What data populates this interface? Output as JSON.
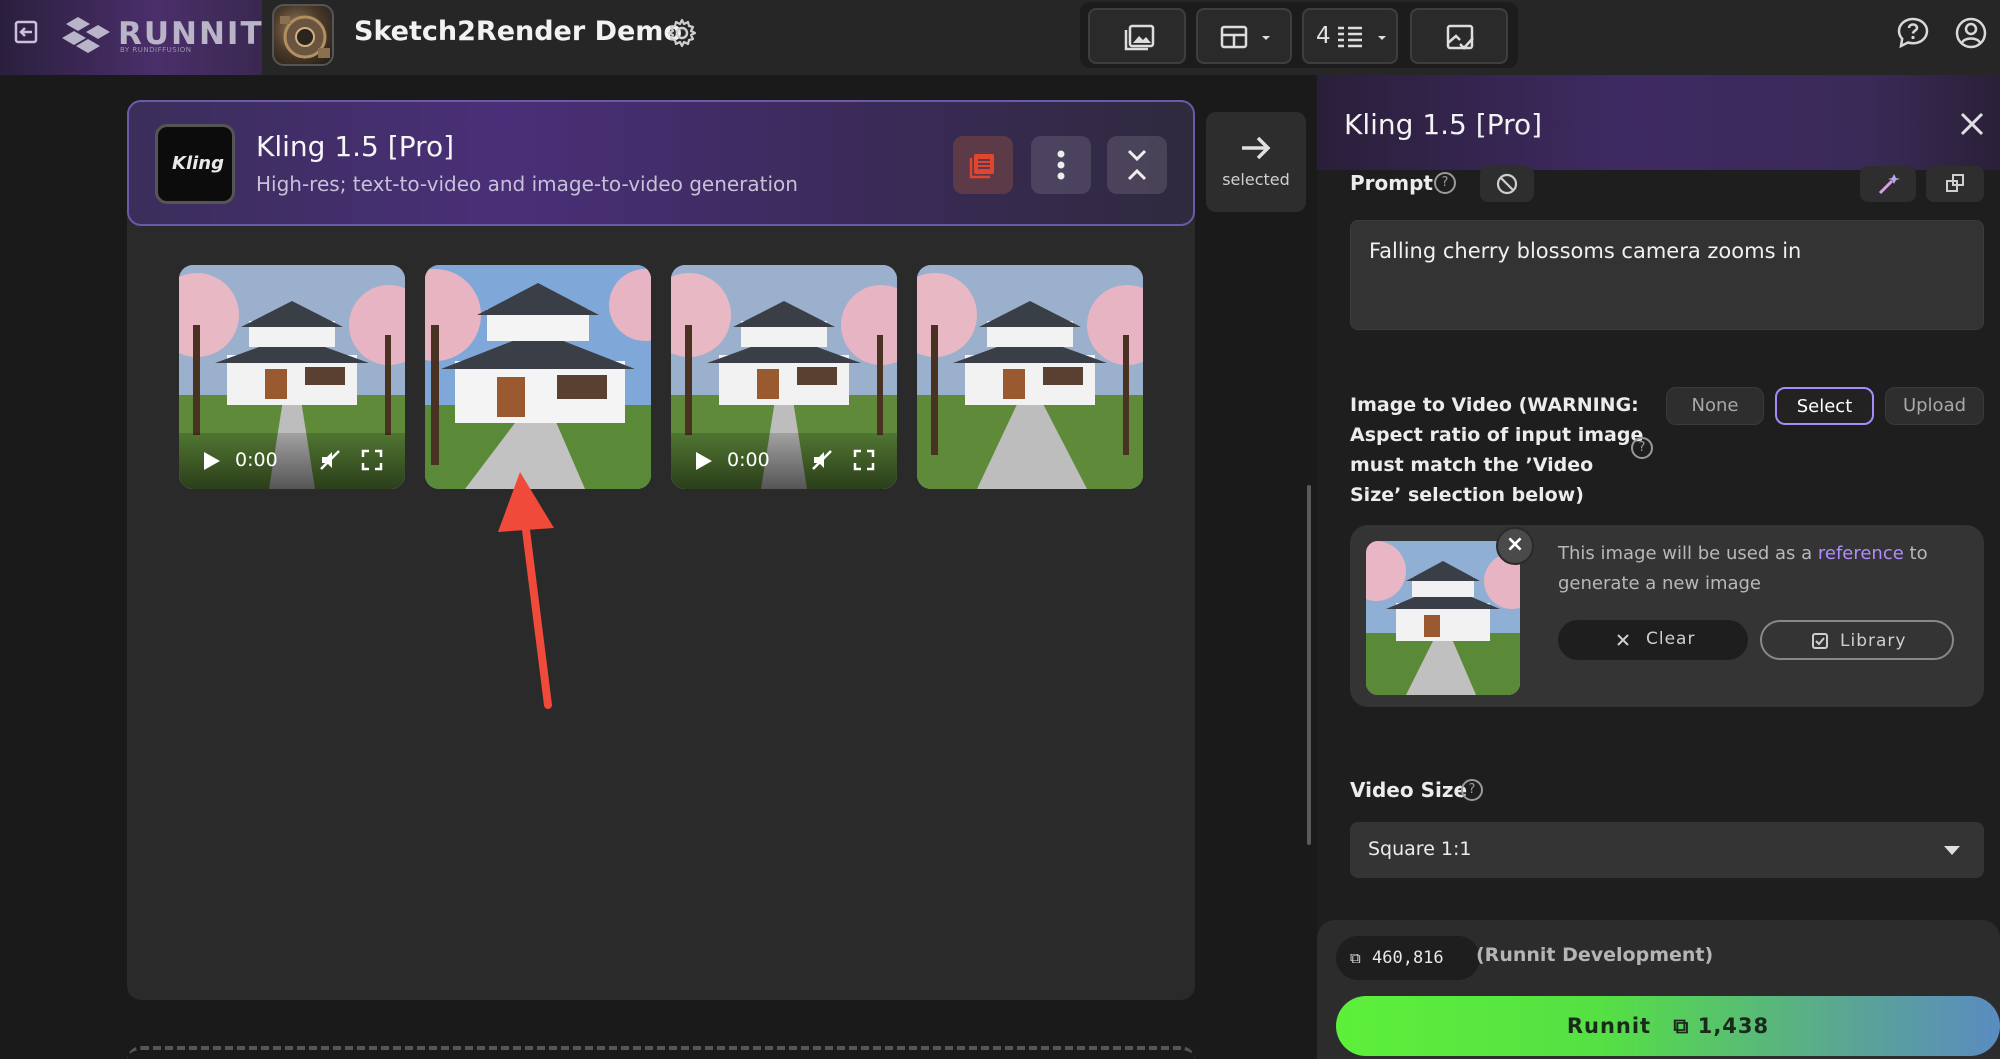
{
  "header": {
    "brand": "RUNNIT",
    "brand_sub": "BY RUNDIFFUSION",
    "project_title": "Sketch2Render Demo",
    "columns_count": "4"
  },
  "model": {
    "name": "Kling 1.5 [Pro]",
    "description": "High-res; text-to-video and image-to-video generation",
    "icon_text": "Kling"
  },
  "selected_label": "selected",
  "videos": [
    {
      "time": "0:00",
      "has_controls": true
    },
    {
      "time": "",
      "has_controls": false
    },
    {
      "time": "0:00",
      "has_controls": true
    },
    {
      "time": "",
      "has_controls": false
    }
  ],
  "panel": {
    "title": "Kling 1.5 [Pro]",
    "prompt_label": "Prompt",
    "prompt_value": "Falling cherry blossoms camera zooms in",
    "i2v_label_line1": "Image to Video (WARNING:",
    "i2v_label_line2": "Aspect ratio of input image",
    "i2v_label_line3": "must match the ’Video",
    "i2v_label_line4": "Size’ selection below)",
    "options": [
      "None",
      "Select",
      "Upload"
    ],
    "selected_option": "Select",
    "ref_text_before": "This image will be used as a ",
    "ref_text_highlight": "reference",
    "ref_text_after": " to generate a new image",
    "clear_label": "Clear",
    "library_label": "Library",
    "video_size_label": "Video Size",
    "video_size_value": "Square 1:1"
  },
  "footer": {
    "credits": "460,816",
    "account": "(Runnit Development)",
    "run_label": "Runnit",
    "run_cost": "1,438"
  },
  "colors": {
    "accent": "#a78bfa",
    "run_green": "#5df03a",
    "arrow_red": "#f04a3a"
  }
}
